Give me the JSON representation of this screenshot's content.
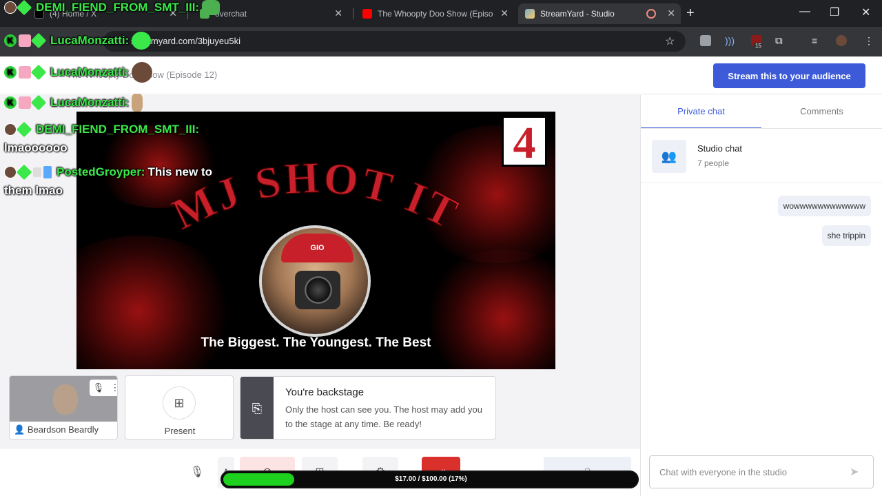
{
  "browser": {
    "tabs": [
      {
        "title": "(4) Home / X",
        "favicon": "x-icon"
      },
      {
        "title": "overchat",
        "favicon": "pepe-icon"
      },
      {
        "title": "The Whoopty Doo Show (Episo",
        "favicon": "youtube-icon"
      },
      {
        "title": "StreamYard - Studio",
        "favicon": "streamyard-icon",
        "active": true
      }
    ],
    "url": "streamyard.com/3bjuyeu5ki",
    "extension_badge": "15"
  },
  "header": {
    "broadcast_title": "The Whoopty Doo Show (Episode 12)",
    "stream_button": "Stream this to your audience"
  },
  "stage": {
    "logo_title": "MJ SHOT IT",
    "cap_text": "GIO",
    "badge_number": "4",
    "tagline": "The Biggest. The Youngest. The Best"
  },
  "participants": {
    "camera_name": "Beardson Beardly",
    "present_label": "Present"
  },
  "backstage": {
    "title": "You're backstage",
    "body": "Only the host can see you. The host may add you to the stage at any time. Be ready!"
  },
  "donation": {
    "text": "$17.00 / $100.00 (17%)",
    "progress": 0.17,
    "fill_color": "#1ed11e"
  },
  "chat_overlay": [
    {
      "user": "DEMI_FIEND_FROM_SMT_III:",
      "text": ""
    },
    {
      "user": "LucaMonzatti:",
      "text": ""
    },
    {
      "user": "LucaMonzatti:",
      "text": ""
    },
    {
      "user": "LucaMonzatti:",
      "text": ""
    },
    {
      "user": "DEMI_FIEND_FROM_SMT_III:",
      "text": "lmaoooooo"
    },
    {
      "user": "PostedGroyper:",
      "text": "This new to",
      "text2": "them lmao"
    }
  ],
  "panel": {
    "tab_private": "Private chat",
    "tab_comments": "Comments",
    "studio_chat_title": "Studio chat",
    "studio_chat_sub": "7 people",
    "messages": [
      "wowwwwwwwwwwww",
      "she trippin"
    ],
    "input_placeholder": "Chat with everyone in the studio"
  },
  "colors": {
    "accent": "#3d5bd9",
    "chat_user": "#3be84a",
    "logo_red": "#c8202a"
  }
}
